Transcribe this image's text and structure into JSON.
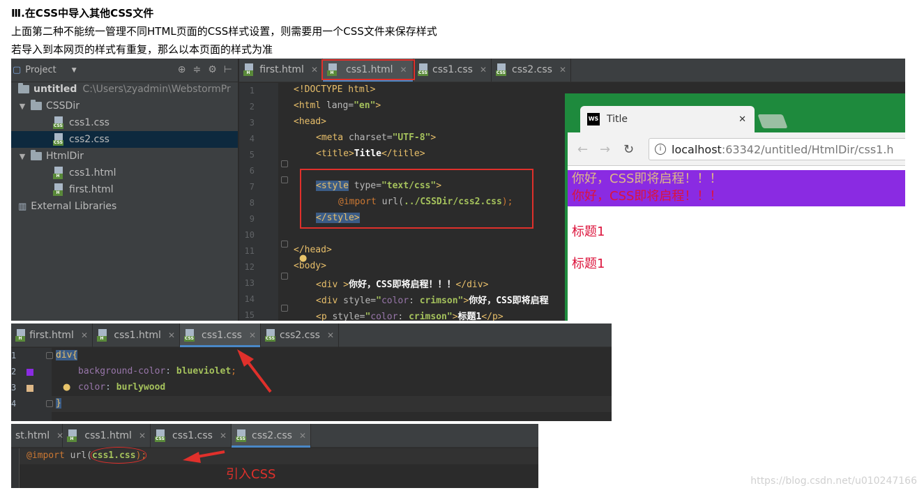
{
  "article": {
    "heading": "Ⅲ.在CSS中导入其他CSS文件",
    "line1": "上面第二种不能统一管理不同HTML页面的CSS样式设置，则需要用一个CSS文件来保存样式",
    "line2": "若导入到本网页的样式有重复，那么以本页面的样式为准"
  },
  "ide1": {
    "project_panel": {
      "title": "Project",
      "root_name": "untitled",
      "root_path": "C:\\Users\\zyadmin\\WebstormPr",
      "items": [
        {
          "label": "CSSDir",
          "kind": "folder"
        },
        {
          "label": "css1.css",
          "kind": "css"
        },
        {
          "label": "css2.css",
          "kind": "css"
        },
        {
          "label": "HtmlDir",
          "kind": "folder"
        },
        {
          "label": "css1.html",
          "kind": "html"
        },
        {
          "label": "first.html",
          "kind": "html"
        },
        {
          "label": "External Libraries",
          "kind": "lib"
        }
      ]
    },
    "tabs": [
      "first.html",
      "css1.html",
      "css1.css",
      "css2.css"
    ],
    "active_tab": "css1.html",
    "line_numbers": [
      "1",
      "2",
      "3",
      "4",
      "5",
      "6",
      "7",
      "8",
      "9",
      "10",
      "11",
      "12",
      "13",
      "14",
      "15"
    ],
    "code": {
      "l1": "<!DOCTYPE html>",
      "l2a": "<html ",
      "l2b": "lang=",
      "l2c": "\"en\"",
      "l2d": ">",
      "l3": "<head>",
      "l4a": "<meta ",
      "l4b": "charset=",
      "l4c": "\"UTF-8\"",
      "l4d": ">",
      "l5a": "<title>",
      "l5b": "Title",
      "l5c": "</title>",
      "l7a": "<style",
      "l7b": " type=",
      "l7c": "\"text/css\"",
      "l7d": ">",
      "l8a": "@import ",
      "l8b": "url(",
      "l8c": "../CSSDir/css2.css",
      "l8d": ");",
      "l9": "</style>",
      "l11": "</head>",
      "l12": "<body>",
      "l13a": "<div >",
      "l13b": "你好，CSS即将启程！！！",
      "l13c": "</div>",
      "l14a": "<div ",
      "l14b": "style=",
      "l14c": "\"",
      "l14d": "color",
      "l14e": ": ",
      "l14f": "crimson",
      "l14g": "\"",
      "l14h": ">",
      "l14i": "你好，CSS即将启程",
      "l15a": "<p ",
      "l15b": "style=",
      "l15c": "\"",
      "l15d": "color",
      "l15e": ": ",
      "l15f": "crimson",
      "l15g": "\"",
      "l15h": ">",
      "l15i": "标题1",
      "l15j": "</p>"
    },
    "browser": {
      "tab_title": "Title",
      "ws_badge": "WS",
      "url_host": "localhost",
      "url_rest": ":63342/untitled/HtmlDir/css1.h",
      "text1": "你好，CSS即将启程！！！",
      "text2": "你好，CSS即将启程！！！",
      "heading1": "标题1",
      "heading2": "标题1"
    }
  },
  "ide2": {
    "tabs": [
      "first.html",
      "css1.html",
      "css1.css",
      "css2.css"
    ],
    "active_tab": "css1.css",
    "line_numbers": [
      "1",
      "2",
      "3",
      "4"
    ],
    "code": {
      "l1": "div{",
      "l2a": "background-color",
      "l2b": ": ",
      "l2c": "blueviolet",
      "l2d": ";",
      "l3a": "color",
      "l3b": ": ",
      "l3c": "burlywood",
      "l4": "}"
    },
    "swatches": {
      "line2": "#8a2be2",
      "line3": "#deb887"
    }
  },
  "ide3": {
    "tabs": [
      "st.html",
      "css1.html",
      "css1.css",
      "css2.css"
    ],
    "active_tab": "css2.css",
    "code": {
      "a": "@import ",
      "b": "url(",
      "c": "css1.css",
      "d": ");"
    }
  },
  "annotation": "引入CSS",
  "watermark": "https://blog.csdn.net/u010247166",
  "colors": {
    "accent_red": "#e0302b",
    "crimson": "#dc143c",
    "blueviolet": "#8a2be2",
    "burlywood": "#deb887",
    "chrome_green": "#1e8a3d"
  }
}
